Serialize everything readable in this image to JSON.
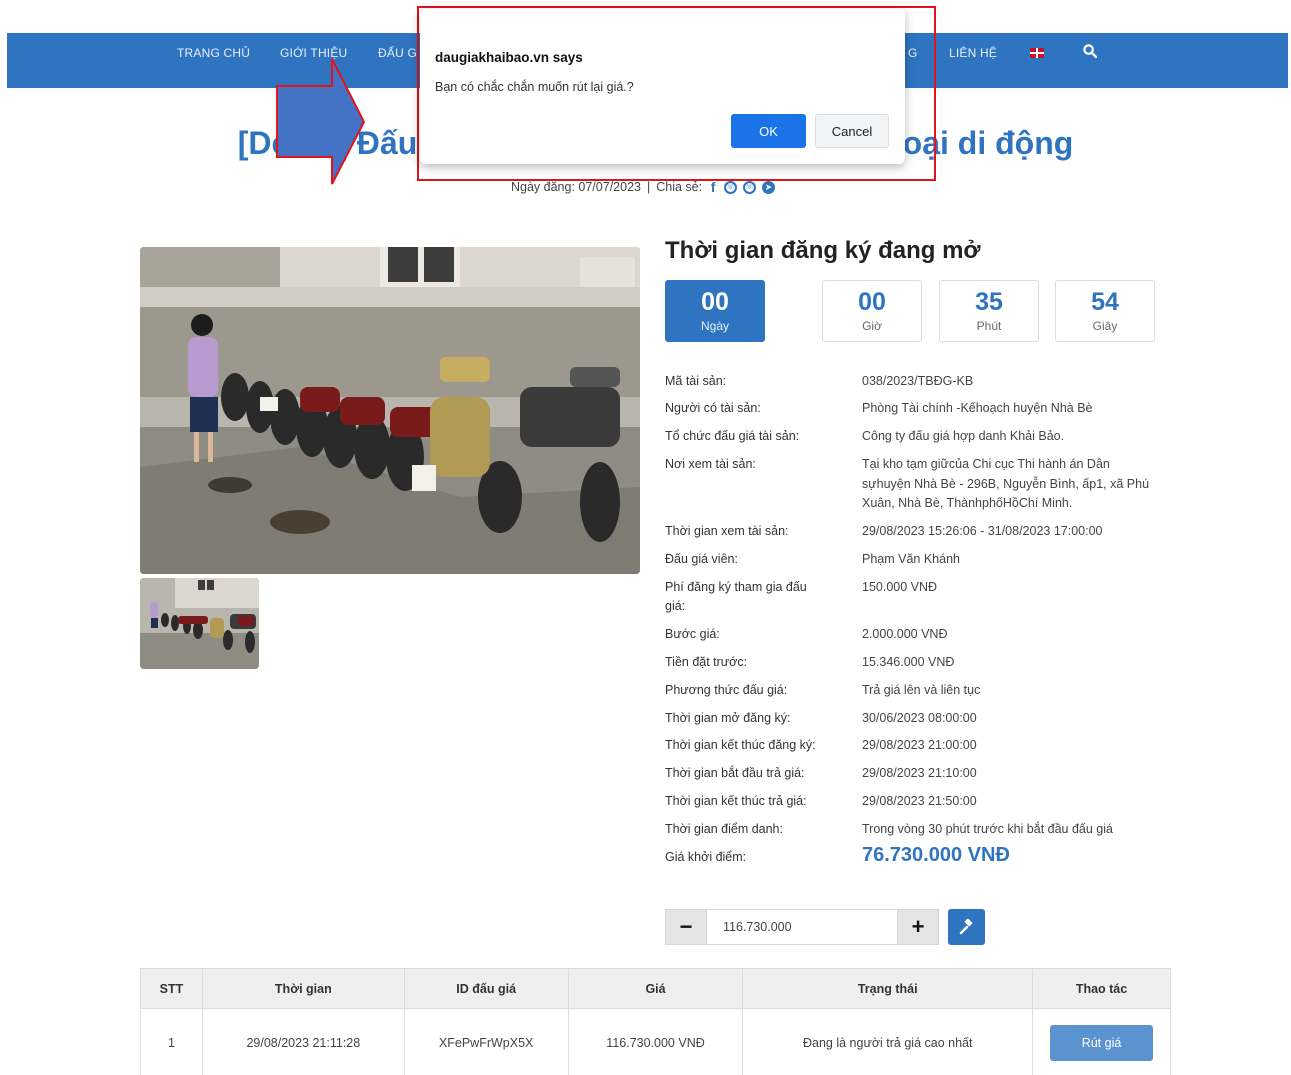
{
  "nav": {
    "items": [
      "TRANG CHỦ",
      "GIỚI THIỆU",
      "ĐẤU G",
      "G",
      "LIÊN HỆ"
    ]
  },
  "page": {
    "title": "[Demo] Đấu giá                                             thoại di động",
    "date_label": "Ngày đăng: 07/07/2023",
    "share_label": "Chia sẻ:"
  },
  "registration": {
    "title": "Thời gian đăng ký đang mở",
    "countdown": [
      {
        "value": "00",
        "label": "Ngày"
      },
      {
        "value": "00",
        "label": "Giờ"
      },
      {
        "value": "35",
        "label": "Phút"
      },
      {
        "value": "54",
        "label": "Giây"
      }
    ]
  },
  "details": [
    {
      "label": "Mã tài sản:",
      "value": "038/2023/TBĐG-KB"
    },
    {
      "label": "Người có tài sản:",
      "value": "Phòng Tài chính -Kếhoạch huyện Nhà Bè"
    },
    {
      "label": "Tổ chức đấu giá tài sản:",
      "value": "Công ty đấu giá hợp danh Khải Bảo."
    },
    {
      "label": "Nơi xem tài sản:",
      "value": "Tại kho tạm giữcủa Chi cục Thi hành án Dân sựhuyện Nhà Bè - 296B, Nguyễn Bình, ấp1, xã Phú Xuân, Nhà Bè, ThànhphốHồChí Minh."
    },
    {
      "label": "Thời gian xem tài sản:",
      "value": "29/08/2023 15:26:06 - 31/08/2023 17:00:00"
    },
    {
      "label": "Đấu giá viên:",
      "value": "Phạm Văn Khánh"
    },
    {
      "label": "Phí đăng ký tham gia đấu giá:",
      "value": "150.000 VNĐ"
    },
    {
      "label": "Bước giá:",
      "value": "2.000.000 VNĐ"
    },
    {
      "label": "Tiền đặt trước:",
      "value": "15.346.000 VNĐ"
    },
    {
      "label": "Phương thức đấu giá:",
      "value": "Trả giá lên và liên tục"
    },
    {
      "label": "Thời gian mở đăng ký:",
      "value": "30/06/2023 08:00:00"
    },
    {
      "label": "Thời gian kết thúc đăng ký:",
      "value": "29/08/2023 21:00:00"
    },
    {
      "label": "Thời gian bắt đầu trả giá:",
      "value": "29/08/2023 21:10:00"
    },
    {
      "label": "Thời gian kết thúc trả giá:",
      "value": "29/08/2023 21:50:00"
    },
    {
      "label": "Thời gian điểm danh:",
      "value": "Trong vòng 30 phút trước khi bắt đầu đấu giá"
    },
    {
      "label": "Giá khởi điểm:",
      "value": "76.730.000 VNĐ"
    }
  ],
  "bid": {
    "minus": "−",
    "plus": "+",
    "value": "116.730.000"
  },
  "table": {
    "headers": [
      "STT",
      "Thời gian",
      "ID đấu giá",
      "Giá",
      "Trạng thái",
      "Thao tác"
    ],
    "rows": [
      {
        "stt": "1",
        "time": "29/08/2023 21:11:28",
        "id": "XFePwFrWpX5X",
        "price": "116.730.000 VNĐ",
        "status": "Đang là người trả giá cao nhất",
        "action": "Rút giá"
      }
    ]
  },
  "dialog": {
    "title": "daugiakhaibao.vn says",
    "message": "Bạn có chắc chắn muốn rút lại giá.?",
    "ok": "OK",
    "cancel": "Cancel"
  },
  "colors": {
    "brand": "#2f74c1",
    "dialog_ok": "#1a73e8",
    "highlight": "#e2131a",
    "arrow": "#4472c4"
  }
}
